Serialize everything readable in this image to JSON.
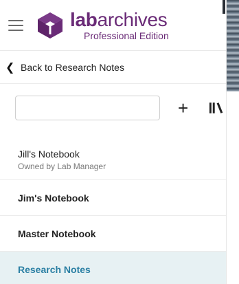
{
  "brand": {
    "word_bold": "lab",
    "word_regular": "archives",
    "edition": "Professional Edition",
    "color": "#6a2b77"
  },
  "nav": {
    "back_label": "Back to Research Notes"
  },
  "toolbar": {
    "search_value": "",
    "add_glyph": "+",
    "library_icon": "library-icon"
  },
  "notebooks": [
    {
      "name": "Jill's Notebook",
      "owner": "Owned by Lab Manager",
      "bold": false,
      "active": false
    },
    {
      "name": "Jim's Notebook",
      "owner": "",
      "bold": true,
      "active": false
    },
    {
      "name": "Master Notebook",
      "owner": "",
      "bold": true,
      "active": false
    },
    {
      "name": "Research Notes",
      "owner": "",
      "bold": true,
      "active": true
    }
  ],
  "colors": {
    "active_bg": "#e7f1f3",
    "active_text": "#2a7fa3"
  }
}
